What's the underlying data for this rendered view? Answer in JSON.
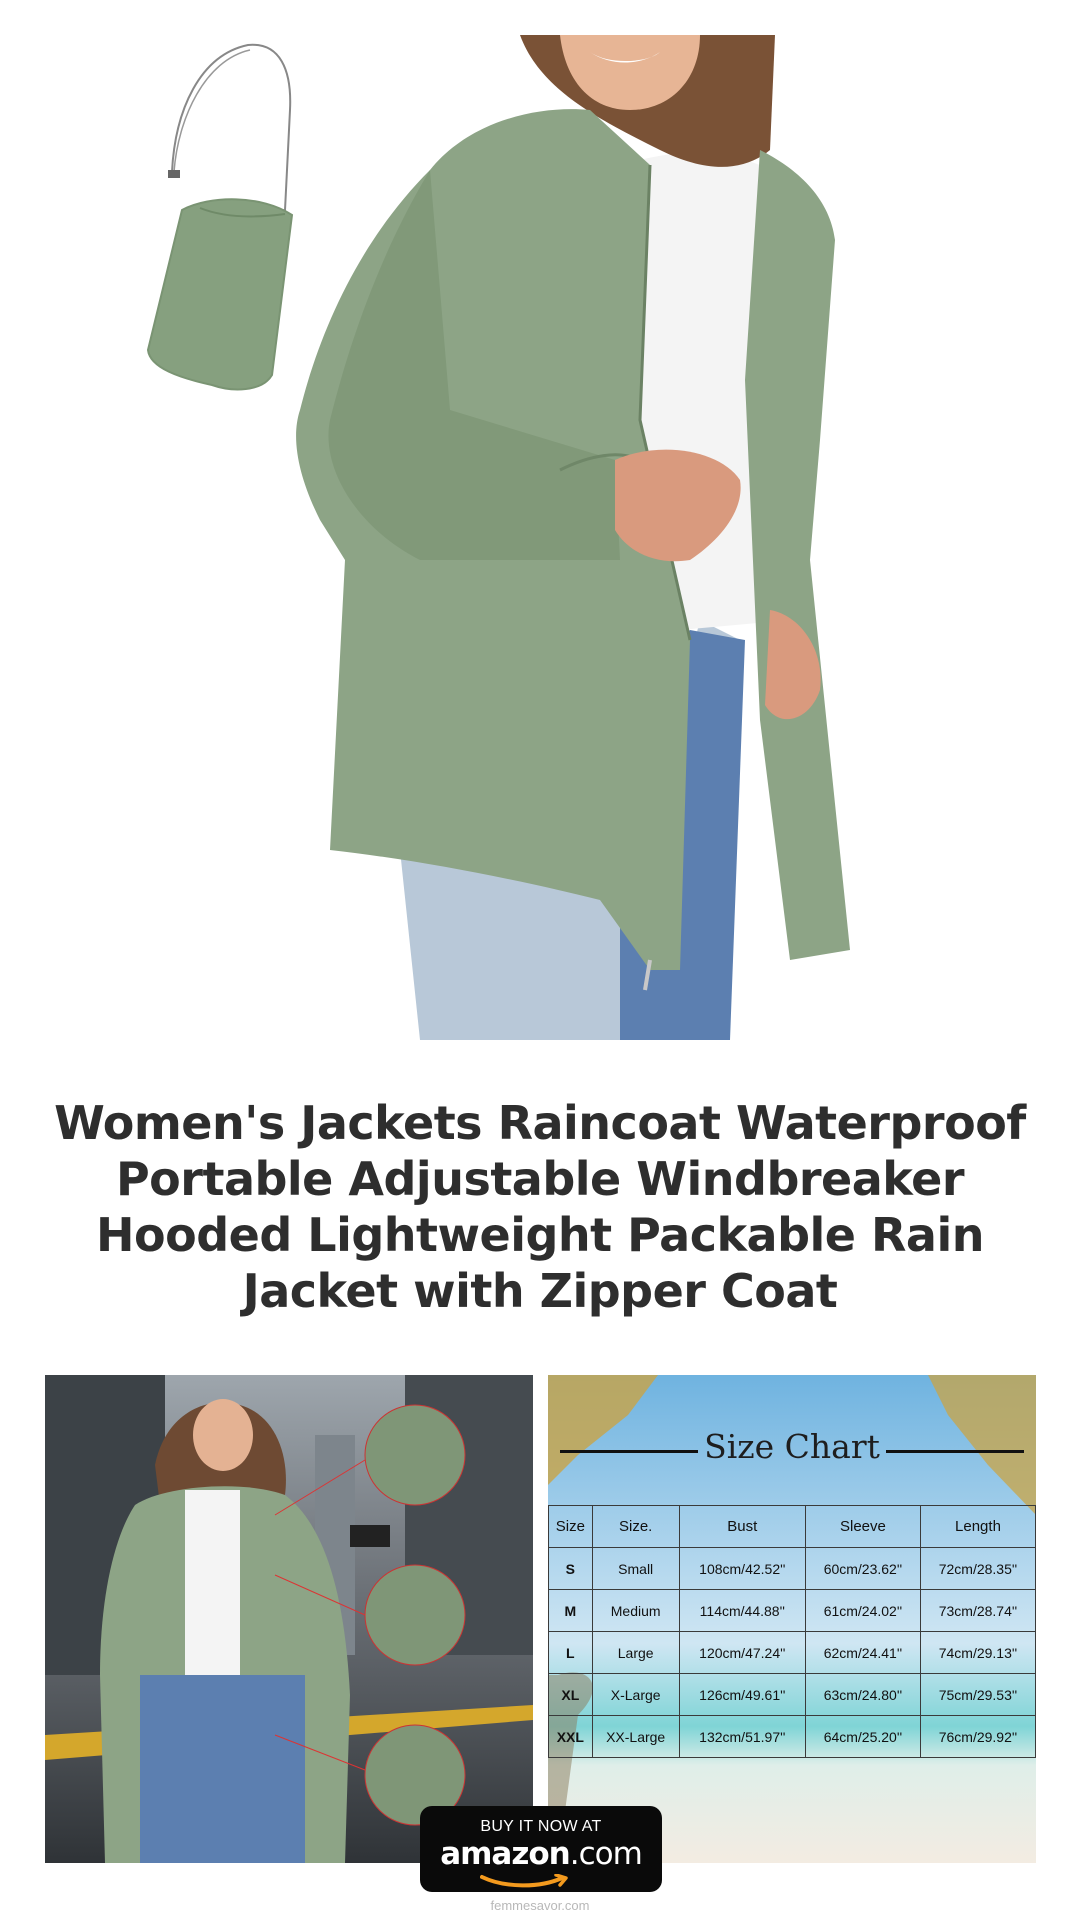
{
  "product": {
    "title": "Women's Jackets Raincoat Waterproof Portable Adjustable Windbreaker Hooded Lightweight Packable Rain Jacket with Zipper Coat",
    "jacket_color": "#8da486"
  },
  "size_chart": {
    "title": "Size Chart",
    "columns": [
      "Size",
      "Size.",
      "Bust",
      "Sleeve",
      "Length"
    ],
    "rows": [
      [
        "S",
        "Small",
        "108cm/42.52''",
        "60cm/23.62''",
        "72cm/28.35''"
      ],
      [
        "M",
        "Medium",
        "114cm/44.88''",
        "61cm/24.02''",
        "73cm/28.74''"
      ],
      [
        "L",
        "Large",
        "120cm/47.24''",
        "62cm/24.41''",
        "74cm/29.13''"
      ],
      [
        "XL",
        "X-Large",
        "126cm/49.61''",
        "63cm/24.80''",
        "75cm/29.53''"
      ],
      [
        "XXL",
        "XX-Large",
        "132cm/51.97''",
        "64cm/25.20''",
        "76cm/29.92''"
      ]
    ]
  },
  "buy_button": {
    "top_text": "BUY IT NOW AT",
    "brand": "amazon",
    "suffix": ".com",
    "smile_color": "#f39a1e"
  },
  "footer": {
    "site": "femmesavor.com"
  },
  "icons": [
    "amazon-smile-icon"
  ]
}
